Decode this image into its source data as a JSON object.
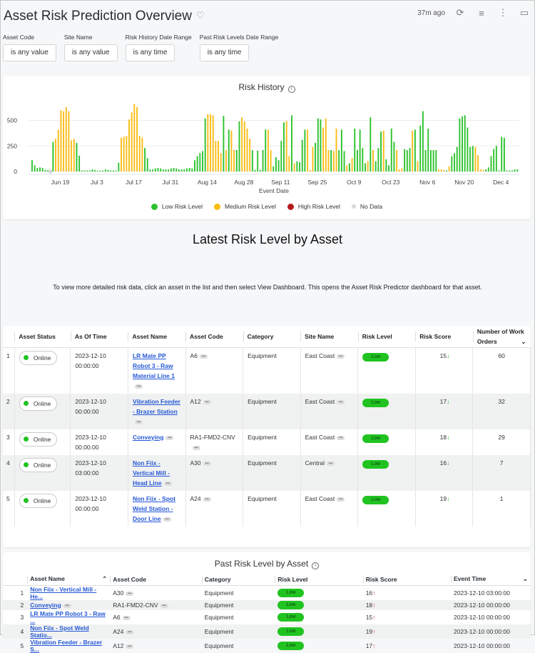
{
  "header": {
    "title": "Asset Risk Prediction Overview",
    "updated": "37m ago"
  },
  "filters": [
    {
      "label": "Asset Code",
      "value": "is any value"
    },
    {
      "label": "Site Name",
      "value": "is any value"
    },
    {
      "label": "Risk History Date Range",
      "value": "is any time"
    },
    {
      "label": "Past Risk Levels Date Range",
      "value": "is any time"
    }
  ],
  "chart_data": {
    "type": "bar",
    "title": "Risk History",
    "xlabel": "Event Date",
    "ylabel": "",
    "ylim": [
      0,
      700
    ],
    "yticks": [
      0,
      250,
      500
    ],
    "xticks": [
      "Jun 19",
      "Jul 3",
      "Jul 17",
      "Jul 31",
      "Aug 14",
      "Aug 28",
      "Sep 11",
      "Sep 25",
      "Oct 9",
      "Oct 23",
      "Nov 6",
      "Nov 20",
      "Dec 4"
    ],
    "start_date": "Jun 8",
    "legend": [
      {
        "name": "Low Risk Level",
        "color": "#2dc22d"
      },
      {
        "name": "Medium Risk Level",
        "color": "#fbbc16"
      },
      {
        "name": "High Risk Level",
        "color": "#b31b1b"
      },
      {
        "name": "No Data",
        "color": "#d8d8d8"
      }
    ],
    "legend_position": "bottom",
    "values": [
      110,
      60,
      35,
      40,
      35,
      15,
      12,
      0,
      290,
      320,
      410,
      600,
      590,
      630,
      590,
      305,
      320,
      280,
      155,
      10,
      10,
      10,
      10,
      20,
      15,
      8,
      8,
      10,
      20,
      15,
      10,
      10,
      8,
      85,
      330,
      340,
      350,
      510,
      580,
      660,
      630,
      350,
      330,
      230,
      130,
      20,
      20,
      30,
      35,
      30,
      20,
      20,
      20,
      30,
      35,
      30,
      20,
      20,
      20,
      30,
      35,
      30,
      110,
      150,
      180,
      200,
      520,
      560,
      560,
      550,
      300,
      300,
      180,
      545,
      210,
      410,
      400,
      210,
      210,
      490,
      530,
      490,
      420,
      320,
      210,
      15,
      205,
      15,
      210,
      410,
      410,
      210,
      50,
      140,
      110,
      300,
      480,
      495,
      150,
      550,
      80,
      100,
      90,
      310,
      410,
      410,
      15,
      240,
      280,
      520,
      510,
      430,
      520,
      210,
      210,
      200,
      420,
      210,
      410,
      200,
      60,
      80,
      130,
      420,
      210,
      410,
      230,
      80,
      100,
      530,
      210,
      100,
      230,
      390,
      400,
      120,
      60,
      420,
      290,
      210,
      20,
      30,
      220,
      210,
      230,
      400,
      410,
      100,
      450,
      590,
      210,
      420,
      210,
      210,
      210,
      20,
      20,
      15,
      10,
      50,
      150,
      180,
      240,
      520,
      540,
      550,
      430,
      240,
      250,
      240,
      160,
      20,
      15,
      20,
      40,
      150,
      220,
      250,
      10,
      340,
      330,
      10,
      10,
      10,
      20,
      20
    ],
    "levels": "L=low, M=medium, N=no data"
  },
  "chart_levels": "LLLLLLLNLMMMMMMMMLLLLLLLLLLLLLLLLLMMMMMMMMMLLLLLLLLLLLLLLLLLLLLLLLLMMMMMMLMLMMLLMMMMLLLLLLMMLLLLLMMLMLLLLMMMLLLMMMLMMLLLMLMLLLLLMLMLLLMLLLLMMMLLLMLMLLLLLLLMMMLMLLLLLLLLLMMMMLLLLLLLLLLLLLLLLMMLLLLLL",
  "latest": {
    "title": "Latest Risk Level by Asset",
    "note": "To view more detailed risk data, click an asset in the list and then select View Dashboard. This opens the Asset Risk Predictor dashboard for that asset.",
    "columns": [
      "Asset Status",
      "As Of Time",
      "Asset Name",
      "Asset Code",
      "Category",
      "Site Name",
      "Risk Level",
      "Risk Score",
      "Number of Work Orders"
    ],
    "rows": [
      {
        "idx": "1",
        "status": "Online",
        "time1": "2023-12-10",
        "time2": "00:00:00",
        "name": "LR Mate PP Robot 3 - Raw Material Line 1",
        "code": "A6",
        "category": "Equipment",
        "site": "East Coast",
        "level": "Low",
        "score": "15",
        "orders": "60"
      },
      {
        "idx": "2",
        "status": "Online",
        "time1": "2023-12-10",
        "time2": "00:00:00",
        "name": "Vibration Feeder - Brazer Station",
        "code": "A12",
        "category": "Equipment",
        "site": "East Coast",
        "level": "Low",
        "score": "17",
        "orders": "32"
      },
      {
        "idx": "3",
        "status": "Online",
        "time1": "2023-12-10",
        "time2": "00:00:00",
        "name": "Conveying",
        "code": "RA1-FMD2-CNV",
        "category": "Equipment",
        "site": "East Coast",
        "level": "Low",
        "score": "18",
        "orders": "29"
      },
      {
        "idx": "4",
        "status": "Online",
        "time1": "2023-12-10",
        "time2": "03:00:00",
        "name": "Non Fiix - Vertical Mill - Head Line",
        "code": "A30",
        "category": "Equipment",
        "site": "Central",
        "level": "Low",
        "score": "16",
        "orders": "7"
      },
      {
        "idx": "5",
        "status": "Online",
        "time1": "2023-12-10",
        "time2": "00:00:00",
        "name": "Non Fiix - Spot Weld Station - Door Line",
        "code": "A24",
        "category": "Equipment",
        "site": "East Coast",
        "level": "Low",
        "score": "19",
        "orders": "1"
      }
    ]
  },
  "past": {
    "title": "Past Risk Level by Asset",
    "columns": [
      "Asset Name",
      "Asset Code",
      "Category",
      "Risk Level",
      "Risk Score",
      "Event Time"
    ],
    "rows": [
      {
        "idx": "1",
        "name": "Non Fiix - Vertical Mill - He...",
        "code": "A30",
        "category": "Equipment",
        "level": "Low",
        "score": "16",
        "time": "2023-12-10 03:00:00"
      },
      {
        "idx": "2",
        "name": "Conveying",
        "code": "RA1-FMD2-CNV",
        "category": "Equipment",
        "level": "Low",
        "score": "18",
        "time": "2023-12-10 00:00:00"
      },
      {
        "idx": "3",
        "name": "LR Mate PP Robot 3 - Raw ...",
        "code": "A6",
        "category": "Equipment",
        "level": "Low",
        "score": "15",
        "time": "2023-12-10 00:00:00"
      },
      {
        "idx": "4",
        "name": "Non Fiix - Spot Weld Statio...",
        "code": "A24",
        "category": "Equipment",
        "level": "Low",
        "score": "19",
        "time": "2023-12-10 00:00:00"
      },
      {
        "idx": "5",
        "name": "Vibration Feeder - Brazer S...",
        "code": "A12",
        "category": "Equipment",
        "level": "Low",
        "score": "17",
        "time": "2023-12-10 00:00:00"
      }
    ]
  }
}
